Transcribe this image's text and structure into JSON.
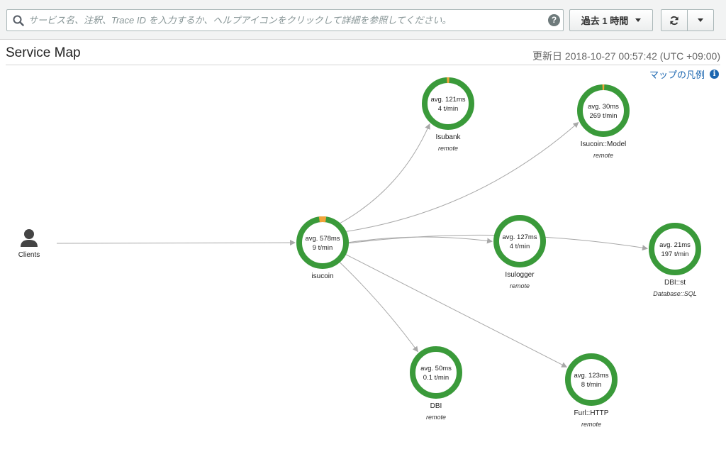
{
  "search": {
    "placeholder": "サービス名、注釈、Trace ID を入力するか、ヘルプアイコンをクリックして詳細を参照してください。",
    "value": "",
    "help_icon": "?"
  },
  "toolbar": {
    "time_range_label": "過去 1 時間",
    "refresh_icon": "⟳"
  },
  "header": {
    "title": "Service Map",
    "updated": "更新日 2018-10-27 00:57:42 (UTC +09:00)",
    "legend_link": "マップの凡例",
    "legend_icon": "i"
  },
  "colors": {
    "ok": "#3a9a3a",
    "error": "#f2a33a",
    "edge": "#a8a8a8",
    "link": "#1b66b0"
  },
  "client": {
    "id": "clients",
    "label": "Clients",
    "icon": "user-icon"
  },
  "nodes": [
    {
      "id": "isucoin",
      "name": "isucoin",
      "avg": "avg. 578ms",
      "rate": "9 t/min",
      "type": "",
      "error_fraction": 0.045
    },
    {
      "id": "isubank",
      "name": "Isubank",
      "avg": "avg. 121ms",
      "rate": "4 t/min",
      "type": "remote",
      "error_fraction": 0.015
    },
    {
      "id": "isucoin-model",
      "name": "Isucoin::Model",
      "avg": "avg. 30ms",
      "rate": "269 t/min",
      "type": "remote",
      "error_fraction": 0.012
    },
    {
      "id": "isulogger",
      "name": "Isulogger",
      "avg": "avg. 127ms",
      "rate": "4 t/min",
      "type": "remote",
      "error_fraction": 0
    },
    {
      "id": "dbi-st",
      "name": "DBI::st",
      "avg": "avg. 21ms",
      "rate": "197 t/min",
      "type": "Database::SQL",
      "error_fraction": 0
    },
    {
      "id": "dbi",
      "name": "DBI",
      "avg": "avg. 50ms",
      "rate": "0.1 t/min",
      "type": "remote",
      "error_fraction": 0
    },
    {
      "id": "furl-http",
      "name": "Furl::HTTP",
      "avg": "avg. 123ms",
      "rate": "8 t/min",
      "type": "remote",
      "error_fraction": 0
    }
  ],
  "edges": [
    {
      "from": "clients",
      "to": "isucoin"
    },
    {
      "from": "isucoin",
      "to": "isubank"
    },
    {
      "from": "isucoin",
      "to": "isucoin-model"
    },
    {
      "from": "isucoin",
      "to": "isulogger"
    },
    {
      "from": "isucoin",
      "to": "dbi-st"
    },
    {
      "from": "isucoin",
      "to": "dbi"
    },
    {
      "from": "isucoin",
      "to": "furl-http"
    }
  ]
}
